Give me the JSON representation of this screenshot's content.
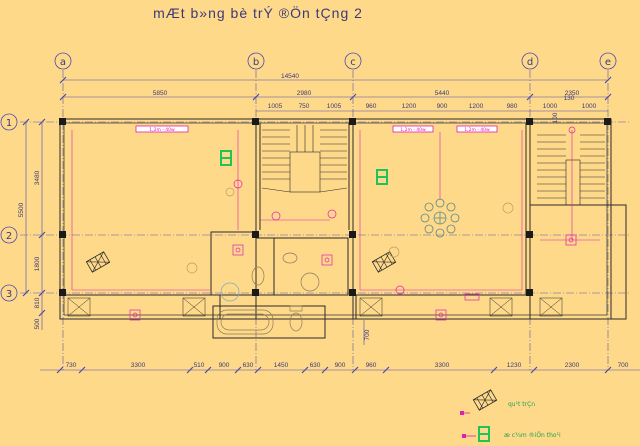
{
  "title": "mÆt b»ng bè trÝ ®Ön tÇng 2",
  "colors": {
    "background": "#FFD98A",
    "wall": "#2B2B2B",
    "dimension": "#4A4AB0",
    "electric": "#E01FB0",
    "fixture": "#8A7A5A",
    "phone": "#22C25A"
  },
  "grid_columns": [
    "a",
    "b",
    "c",
    "d",
    "e"
  ],
  "grid_rows": [
    "1",
    "2",
    "3"
  ],
  "dims_top": {
    "overall": "14540",
    "row1": [
      "5850",
      "2980",
      "5440",
      "2350"
    ],
    "row2": [
      "1005",
      "750",
      "1005",
      "960",
      "1200",
      "900",
      "1200",
      "980",
      "1000",
      "130",
      "1000"
    ]
  },
  "dims_left": [
    "5500",
    "3480",
    "1800",
    "810",
    "500"
  ],
  "dims_right": [
    "100"
  ],
  "dims_bottom": [
    "730",
    "3300",
    "510",
    "900",
    "630",
    "1450",
    "630",
    "900",
    "960",
    "3300",
    "1230",
    "2300",
    "700"
  ],
  "dims_misc": [
    "700"
  ],
  "light_labels": [
    "1,2m - 40w",
    "1,2m - 40w",
    "1,2m - 40w"
  ],
  "legend": [
    {
      "icon": "ceiling-fan-icon",
      "label": "qu¹t trÇn"
    },
    {
      "icon": "phone-outlet-icon",
      "label": "æ c¾m ®iÖn tho¹i"
    }
  ]
}
